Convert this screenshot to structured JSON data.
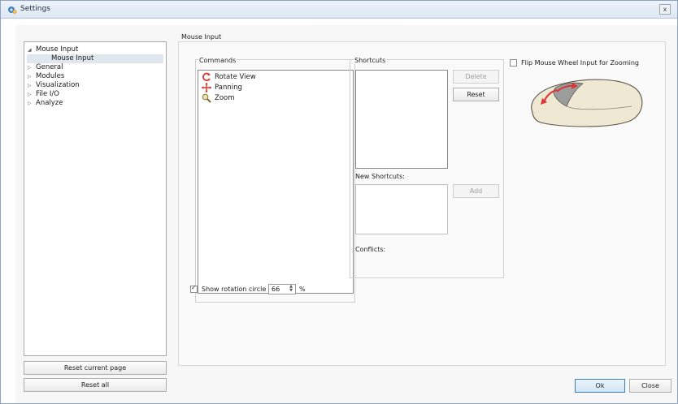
{
  "window": {
    "title": "Settings",
    "close_label": "x"
  },
  "tree": {
    "items": [
      {
        "label": "Mouse Input",
        "expanded": true
      },
      {
        "label": "Mouse Input",
        "child": true,
        "selected": true
      },
      {
        "label": "General"
      },
      {
        "label": "Modules"
      },
      {
        "label": "Visualization"
      },
      {
        "label": "File I/O"
      },
      {
        "label": "Analyze"
      }
    ]
  },
  "left_buttons": {
    "reset_page": "Reset current page",
    "reset_all": "Reset all"
  },
  "page": {
    "heading": "Mouse Input"
  },
  "commands": {
    "label": "Commands",
    "items": [
      {
        "label": "Rotate View",
        "icon": "rotate-icon"
      },
      {
        "label": "Panning",
        "icon": "pan-icon"
      },
      {
        "label": "Zoom",
        "icon": "zoom-icon"
      }
    ]
  },
  "shortcuts": {
    "label": "Shortcuts",
    "delete": "Delete",
    "reset": "Reset",
    "new_label": "New Shortcuts:",
    "add": "Add",
    "conflicts_label": "Conflicts:"
  },
  "flip_wheel": {
    "label": "Flip Mouse Wheel Input for Zooming",
    "checked": false
  },
  "rotation_circle": {
    "label": "Show rotation circle",
    "checked": true,
    "value": "66",
    "unit": "%"
  },
  "footer": {
    "ok": "Ok",
    "close": "Close"
  },
  "colors": {
    "accent": "#3c7fb1",
    "rotate": "#d9382c",
    "mouse_body": "#efe8d2"
  }
}
